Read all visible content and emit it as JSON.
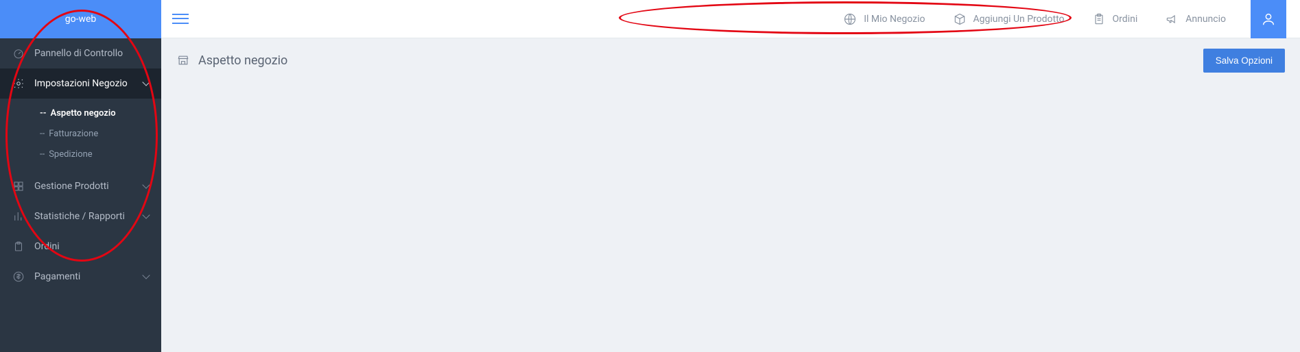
{
  "brand": {
    "title": "go-web"
  },
  "sidebar": {
    "items": [
      {
        "label": "Pannello di Controllo",
        "expandable": false
      },
      {
        "label": "Impostazioni Negozio",
        "expandable": true,
        "active": true
      },
      {
        "label": "Gestione Prodotti",
        "expandable": true
      },
      {
        "label": "Statistiche / Rapporti",
        "expandable": true
      },
      {
        "label": "Ordini",
        "expandable": false
      },
      {
        "label": "Pagamenti",
        "expandable": true
      }
    ],
    "submenu_prefix": "--",
    "submenu": [
      {
        "label": "Aspetto negozio",
        "active": true
      },
      {
        "label": "Fatturazione"
      },
      {
        "label": "Spedizione"
      }
    ]
  },
  "topnav": {
    "links": [
      {
        "label": "Il Mio Negozio"
      },
      {
        "label": "Aggiungi Un Prodotto"
      },
      {
        "label": "Ordini"
      },
      {
        "label": "Annuncio"
      }
    ]
  },
  "page": {
    "title": "Aspetto negozio",
    "save_button": "Salva Opzioni"
  }
}
